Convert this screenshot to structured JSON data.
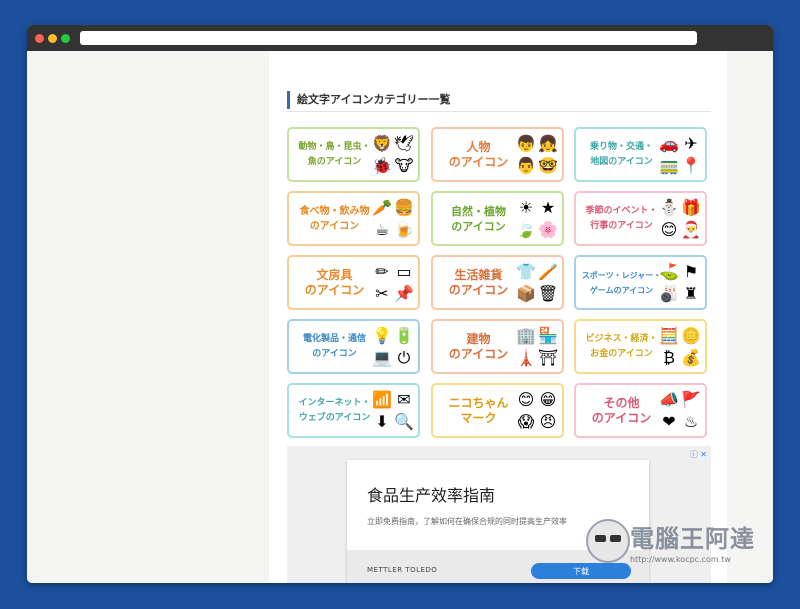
{
  "section_title": "絵文字アイコンカテゴリー一覧",
  "categories": [
    {
      "label": "動物・鳥・昆虫・\n魚のアイコン",
      "border": "#c5e29a",
      "color": "#7aa631",
      "font": "9px",
      "icons": [
        [
          "lion-icon",
          "🦁"
        ],
        [
          "dove-icon",
          "🕊"
        ],
        [
          "ladybug-icon",
          "🐞"
        ],
        [
          "cow-icon",
          "🐮"
        ]
      ]
    },
    {
      "label": "人物\nのアイコン",
      "border": "#f8c6a8",
      "color": "#e57e3c",
      "font": "12px",
      "icons": [
        [
          "boy-face-icon",
          "👦"
        ],
        [
          "girl-face-icon",
          "👧"
        ],
        [
          "man-face-icon",
          "👨"
        ],
        [
          "glasses-man-icon",
          "🤓"
        ]
      ]
    },
    {
      "label": "乗り物・交通・\n地図のアイコン",
      "border": "#a8dfe0",
      "color": "#3fa6a8",
      "font": "9px",
      "icons": [
        [
          "car-icon",
          "🚗"
        ],
        [
          "airplane-icon",
          "✈"
        ],
        [
          "train-icon",
          "🚃"
        ],
        [
          "route-map-icon",
          "📍"
        ]
      ]
    },
    {
      "label": "食べ物・飲み物\nのアイコン",
      "border": "#f8cd95",
      "color": "#e68a2a",
      "font": "10px",
      "icons": [
        [
          "carrot-icon",
          "🥕"
        ],
        [
          "hamburger-icon",
          "🍔"
        ],
        [
          "coffee-cup-icon",
          "☕"
        ],
        [
          "beer-mug-icon",
          "🍺"
        ]
      ]
    },
    {
      "label": "自然・植物\nのアイコン",
      "border": "#c5e29a",
      "color": "#6da52e",
      "font": "11px",
      "icons": [
        [
          "sun-icon",
          "☀"
        ],
        [
          "star-icon",
          "★"
        ],
        [
          "leaf-icon",
          "🍃"
        ],
        [
          "flower-icon",
          "🌸"
        ]
      ]
    },
    {
      "label": "季節のイベント・\n行事のアイコン",
      "border": "#f7c3cc",
      "color": "#d85a72",
      "font": "9px",
      "icons": [
        [
          "snowman-icon",
          "⛄"
        ],
        [
          "gift-icon",
          "🎁"
        ],
        [
          "kid-face-icon",
          "😊"
        ],
        [
          "santa-icon",
          "🎅"
        ]
      ]
    },
    {
      "label": "文房具\nのアイコン",
      "border": "#f8cd95",
      "color": "#e68a2a",
      "font": "12px",
      "icons": [
        [
          "pencil-icon",
          "✏"
        ],
        [
          "eraser-icon",
          "▭"
        ],
        [
          "scissors-icon",
          "✂"
        ],
        [
          "pushpin-icon",
          "📌"
        ]
      ]
    },
    {
      "label": "生活雑貨\nのアイコン",
      "border": "#f8c6a8",
      "color": "#d8703a",
      "font": "12px",
      "icons": [
        [
          "hanger-icon",
          "👕"
        ],
        [
          "toothbrush-icon",
          "🪥"
        ],
        [
          "cardboard-box-icon",
          "📦"
        ],
        [
          "trash-can-icon",
          "🗑"
        ]
      ]
    },
    {
      "label": "スポーツ・レジャー・\nゲームのアイコン",
      "border": "#a8cfe8",
      "color": "#3b8ac4",
      "font": "8px",
      "icons": [
        [
          "golf-club-icon",
          "⛳"
        ],
        [
          "flag-icon",
          "⚑"
        ],
        [
          "bowling-icon",
          "🎳"
        ],
        [
          "shogi-piece-icon",
          "♜"
        ]
      ]
    },
    {
      "label": "電化製品・通信\nのアイコン",
      "border": "#a8cfe8",
      "color": "#3b8ac4",
      "font": "9px",
      "icons": [
        [
          "lightbulb-icon",
          "💡"
        ],
        [
          "battery-icon",
          "🔋"
        ],
        [
          "laptop-icon",
          "💻"
        ],
        [
          "power-icon",
          "⏻"
        ]
      ]
    },
    {
      "label": "建物\nのアイコン",
      "border": "#f8c6a8",
      "color": "#d8703a",
      "font": "12px",
      "icons": [
        [
          "office-building-icon",
          "🏢"
        ],
        [
          "shop-icon",
          "🏪"
        ],
        [
          "tokyo-tower-icon",
          "🗼"
        ],
        [
          "torii-gate-icon",
          "⛩"
        ]
      ]
    },
    {
      "label": "ビジネス・経済・\nお金のアイコン",
      "border": "#f3dd8a",
      "color": "#d2a614",
      "font": "9px",
      "icons": [
        [
          "calculator-icon",
          "🧮"
        ],
        [
          "gold-bar-icon",
          "🪙"
        ],
        [
          "bitcoin-icon",
          "₿"
        ],
        [
          "money-bag-icon",
          "💰"
        ]
      ]
    },
    {
      "label": "インターネット・\nウェブのアイコン",
      "border": "#a8dfe0",
      "color": "#3fa6a8",
      "font": "9px",
      "icons": [
        [
          "wifi-icon",
          "📶"
        ],
        [
          "envelope-icon",
          "✉"
        ],
        [
          "download-icon",
          "⬇"
        ],
        [
          "magnifier-icon",
          "🔍"
        ]
      ]
    },
    {
      "label": "ニコちゃん\nマーク",
      "border": "#f3dd8a",
      "color": "#e09a12",
      "font": "12px",
      "icons": [
        [
          "smiley-icon",
          "😊"
        ],
        [
          "grin-icon",
          "😁"
        ],
        [
          "shocked-face-icon",
          "😱"
        ],
        [
          "angry-face-icon",
          "😠"
        ]
      ]
    },
    {
      "label": "その他\nのアイコン",
      "border": "#f7c3cc",
      "color": "#d85a72",
      "font": "12px",
      "icons": [
        [
          "megaphone-icon",
          "📣"
        ],
        [
          "pennant-flag-icon",
          "🚩"
        ],
        [
          "heart-icon",
          "❤"
        ],
        [
          "hot-spring-icon",
          "♨"
        ]
      ]
    }
  ],
  "ad": {
    "choices": "ⓘ ✕",
    "title": "食品生产效率指南",
    "description": "立即免费指南，了解如何在确保合规的同时提高生产效率",
    "brand": "METTLER TOLEDO",
    "button": "下载"
  },
  "watermark": {
    "text": "電腦王阿達",
    "url": "http://www.kocpc.com.tw"
  }
}
